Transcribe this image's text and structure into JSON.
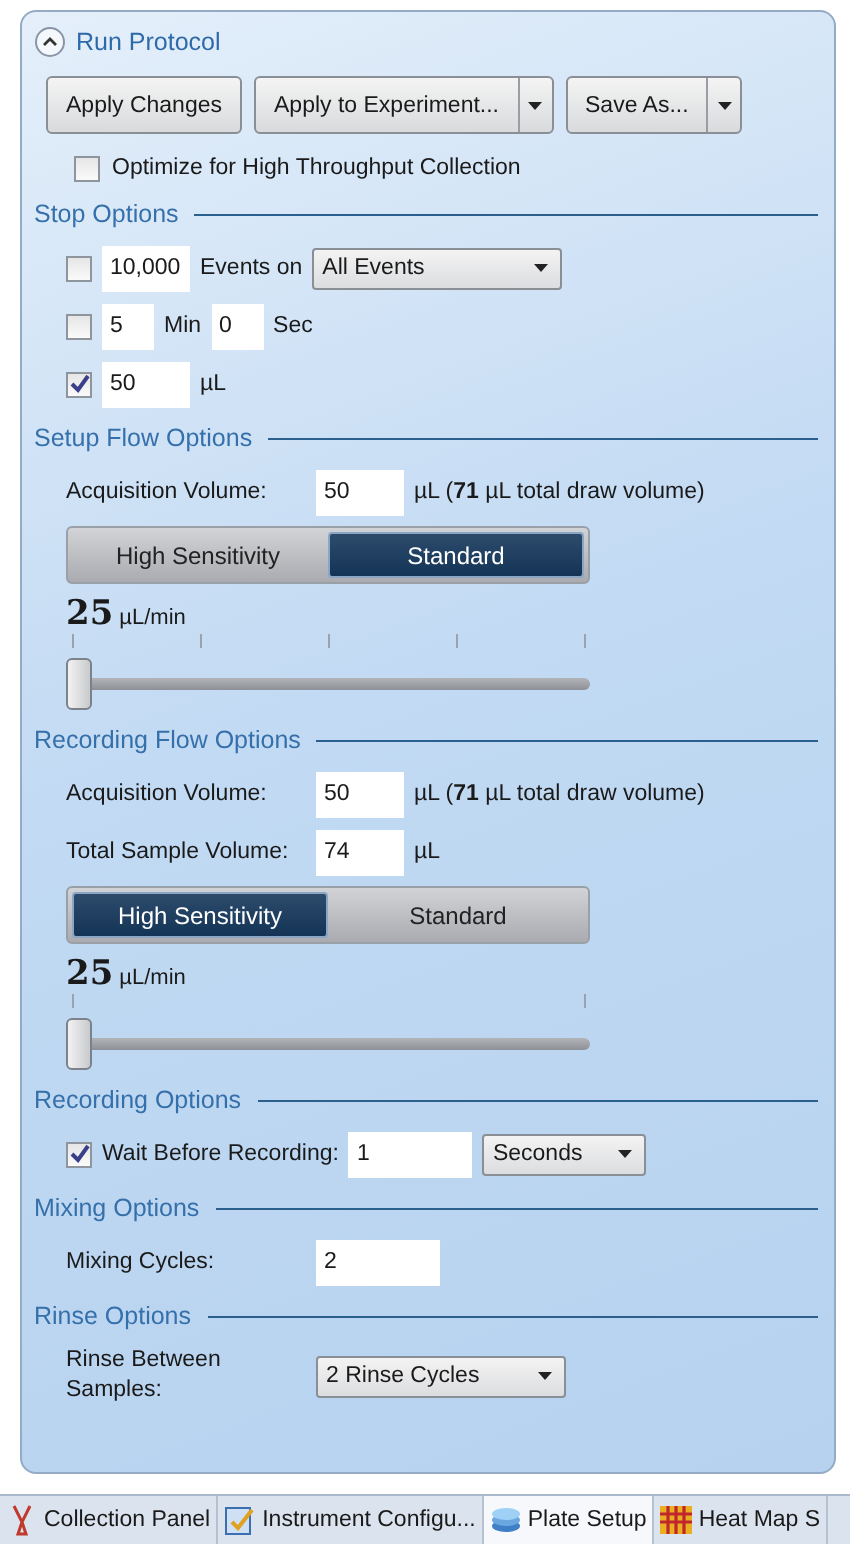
{
  "panel": {
    "title": "Run Protocol",
    "expanded": true
  },
  "buttons": [
    {
      "label": "Apply Changes",
      "dropdown": false
    },
    {
      "label": "Apply to Experiment...",
      "dropdown": true
    },
    {
      "label": "Save As...",
      "dropdown": true
    }
  ],
  "optimize": {
    "label": "Optimize for High Throughput Collection",
    "checked": false
  },
  "sections": [
    {
      "title": "Stop Options",
      "rows": [
        {
          "parts": [
            {
              "kind": "checkbox",
              "checked": false
            },
            {
              "kind": "field",
              "value": "10,000"
            },
            {
              "kind": "text",
              "text": "Events on"
            },
            {
              "kind": "dropdown",
              "value": "All Events"
            }
          ]
        },
        {
          "parts": [
            {
              "kind": "checkbox",
              "checked": false
            },
            {
              "kind": "field",
              "value": "5"
            },
            {
              "kind": "text",
              "text": "Min"
            },
            {
              "kind": "field",
              "value": "0"
            },
            {
              "kind": "text",
              "text": "Sec"
            }
          ]
        },
        {
          "parts": [
            {
              "kind": "checkbox",
              "checked": true
            },
            {
              "kind": "field",
              "value": "50"
            },
            {
              "kind": "text",
              "text": "µL"
            }
          ]
        }
      ]
    },
    {
      "title": "Setup Flow Options",
      "rows": [
        {
          "parts": [
            {
              "kind": "label",
              "text": "Acquisition Volume:"
            },
            {
              "kind": "field",
              "value": "50"
            },
            {
              "kind": "text",
              "text": "µL (**71** µL total draw volume)"
            }
          ]
        },
        {
          "parts": [
            {
              "kind": "toggle",
              "options": [
                {
                  "label": "High Sensitivity",
                  "selected": false
                },
                {
                  "label": "Standard",
                  "selected": true
                }
              ]
            }
          ]
        },
        {
          "parts": [
            {
              "kind": "slider",
              "reading": "25",
              "unit": "µL/min",
              "level": 0
            }
          ]
        }
      ]
    },
    {
      "title": "Recording Flow Options",
      "rows": [
        {
          "parts": [
            {
              "kind": "label",
              "text": "Acquisition Volume:"
            },
            {
              "kind": "field",
              "value": "50"
            },
            {
              "kind": "text",
              "text": "µL (**71** µL total draw volume)"
            }
          ]
        },
        {
          "parts": [
            {
              "kind": "label",
              "text": "Total Sample Volume:"
            },
            {
              "kind": "field",
              "value": "74"
            },
            {
              "kind": "text",
              "text": "µL"
            }
          ]
        },
        {
          "parts": [
            {
              "kind": "toggle",
              "options": [
                {
                  "label": "High Sensitivity",
                  "selected": true
                },
                {
                  "label": "Standard",
                  "selected": false
                }
              ]
            }
          ]
        },
        {
          "parts": [
            {
              "kind": "slider",
              "reading": "25",
              "unit": "µL/min",
              "level": 0
            }
          ]
        }
      ]
    },
    {
      "title": "Recording Options",
      "rows": [
        {
          "parts": [
            {
              "kind": "checkbox",
              "checked": true
            },
            {
              "kind": "text",
              "text": "Wait Before Recording:"
            },
            {
              "kind": "field",
              "value": "1"
            },
            {
              "kind": "dropdown",
              "value": "Seconds"
            }
          ]
        }
      ]
    },
    {
      "title": "Mixing Options",
      "rows": [
        {
          "parts": [
            {
              "kind": "label",
              "text": "Mixing Cycles:"
            },
            {
              "kind": "field",
              "value": "2"
            }
          ]
        }
      ]
    },
    {
      "title": "Rinse Options",
      "rows": [
        {
          "parts": [
            {
              "kind": "label",
              "text": "Rinse Between Samples:"
            },
            {
              "kind": "dropdown",
              "value": "2 Rinse Cycles"
            }
          ]
        }
      ]
    }
  ],
  "bottom_tabs": [
    {
      "label": "Collection Panel",
      "selected": false
    },
    {
      "label": "Instrument Configu...",
      "selected": false
    },
    {
      "label": "Plate Setup",
      "selected": true
    },
    {
      "label": "Heat Map S",
      "selected": false
    }
  ]
}
